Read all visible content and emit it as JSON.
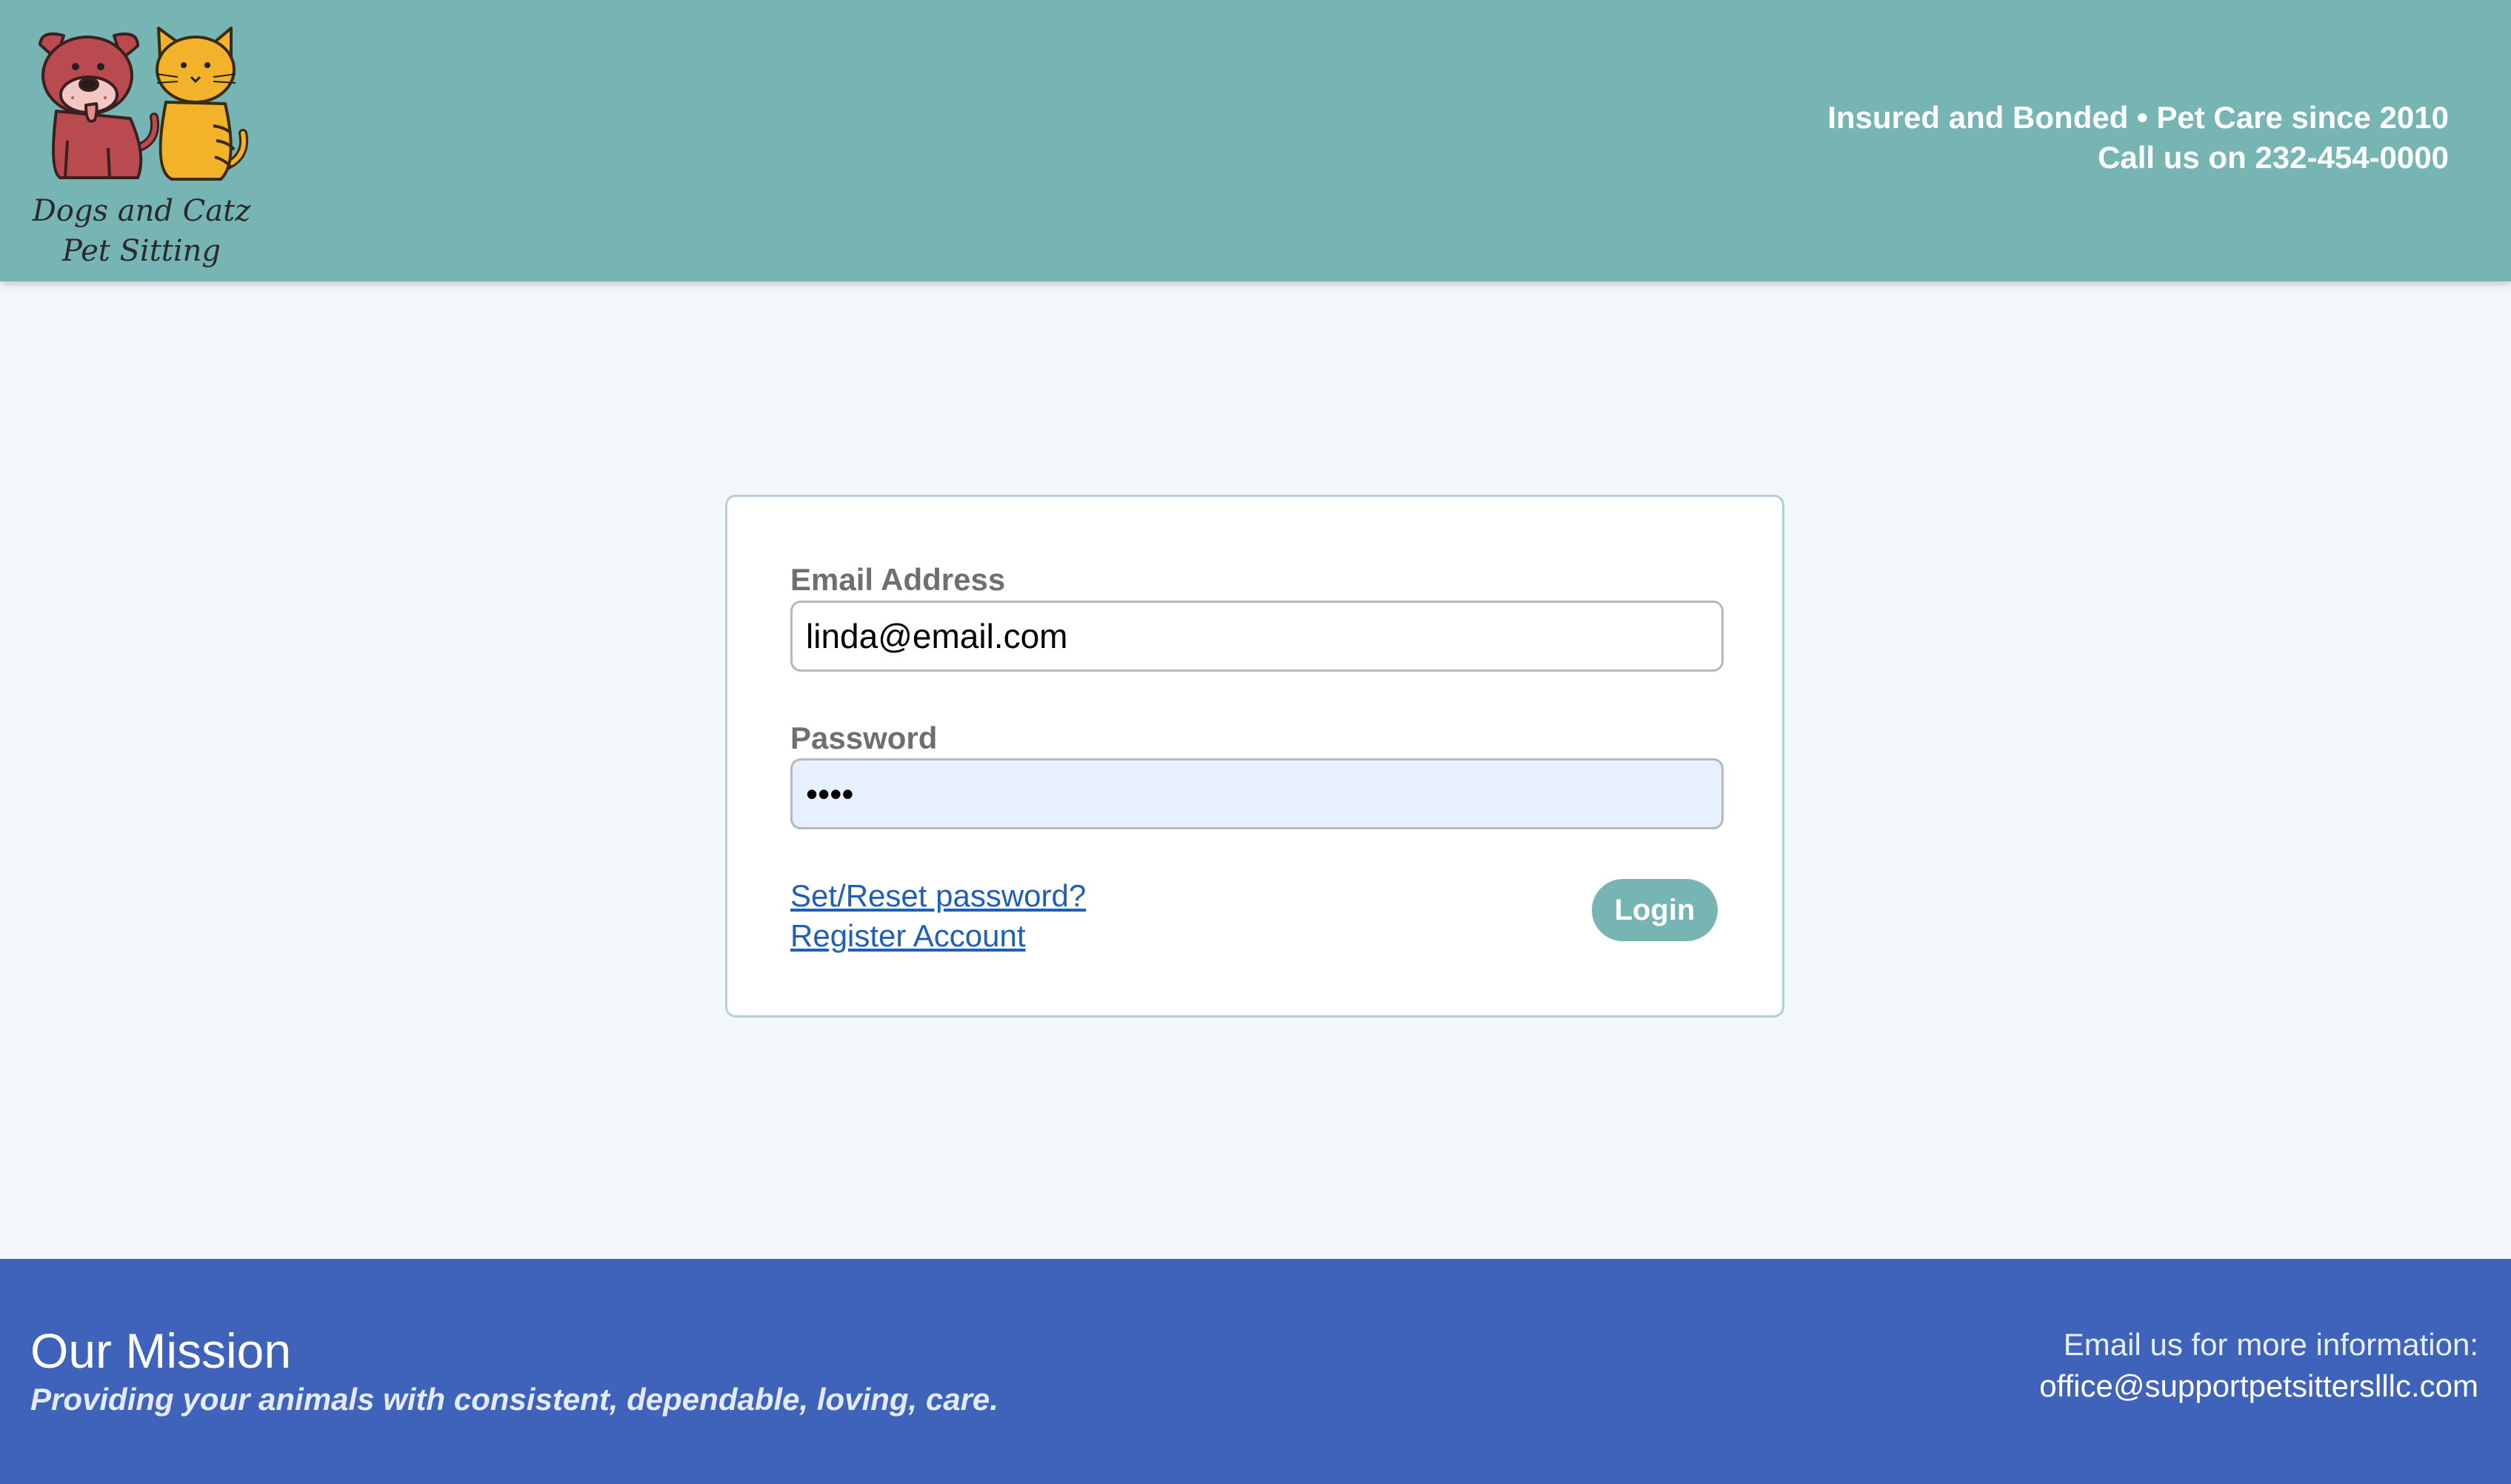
{
  "header": {
    "logo_line1": "Dogs and Catz",
    "logo_line2": "Pet Sitting",
    "tagline": "Insured and Bonded • Pet Care since 2010",
    "phone_line": "Call us on 232-454-0000"
  },
  "login": {
    "email_label": "Email Address",
    "email_value": "linda@email.com",
    "password_label": "Password",
    "password_value": "••••",
    "reset_link": "Set/Reset password?",
    "register_link": "Register Account",
    "login_button": "Login"
  },
  "footer": {
    "mission_title": "Our Mission",
    "mission_text": "Providing your animals with consistent, dependable, loving, care.",
    "contact_label": "Email us for more information:",
    "contact_email": "office@supportpetsitterslllc.com"
  },
  "colors": {
    "header_bg": "#77b5b5",
    "page_bg": "#f2f8fa",
    "footer_bg": "#3f63bb",
    "link": "#1f5fb8",
    "button_bg": "#77b5b5",
    "autofill_bg": "#e7f0fe"
  }
}
